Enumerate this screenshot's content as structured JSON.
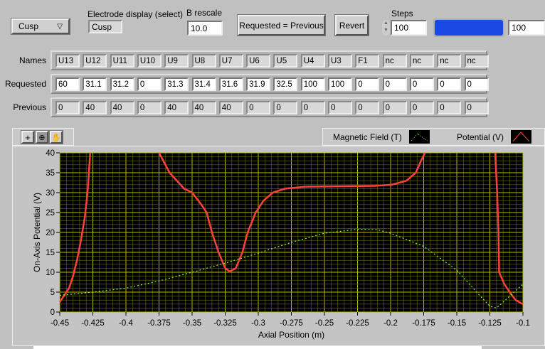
{
  "controls": {
    "mode_select": "Cusp",
    "electrode_display_label": "Electrode display (select)",
    "electrode_display_value": "Cusp",
    "b_rescale_label": "B rescale",
    "b_rescale_value": "10.0",
    "requested_equals_previous": "Requested = Previous",
    "revert": "Revert",
    "steps_label": "Steps",
    "steps_value": "100",
    "progress_percent": 100,
    "progress_color": "#1a49e6",
    "progress_value": "100"
  },
  "table": {
    "row_labels": [
      "Names",
      "Requested",
      "Previous"
    ],
    "names": [
      "U13",
      "U12",
      "U11",
      "U10",
      "U9",
      "U8",
      "U7",
      "U6",
      "U5",
      "U4",
      "U3",
      "F1",
      "nc",
      "nc",
      "nc",
      "nc"
    ],
    "requested": [
      "60",
      "31.1",
      "31.2",
      "0",
      "31.3",
      "31.4",
      "31.6",
      "31.9",
      "32.5",
      "100",
      "100",
      "0",
      "0",
      "0",
      "0",
      "0"
    ],
    "previous": [
      "0",
      "40",
      "40",
      "0",
      "40",
      "40",
      "40",
      "0",
      "0",
      "0",
      "0",
      "0",
      "0",
      "0",
      "0",
      "0"
    ]
  },
  "legend": {
    "magnetic": "Magnetic Field (T)",
    "potential": "Potential (V)"
  },
  "chart_data": {
    "type": "line",
    "xlabel": "Axial Position (m)",
    "ylabel": "On-Axis Potential (V)",
    "xlim": [
      -0.45,
      -0.1
    ],
    "ylim": [
      0,
      40
    ],
    "grid": true,
    "legend_position": "top-right",
    "x_ticks": [
      "-0.45",
      "-0.425",
      "-0.4",
      "-0.375",
      "-0.35",
      "-0.325",
      "-0.3",
      "-0.275",
      "-0.25",
      "-0.225",
      "-0.2",
      "-0.175",
      "-0.15",
      "-0.125",
      "-0.1"
    ],
    "y_ticks": [
      "0",
      "5",
      "10",
      "15",
      "20",
      "25",
      "30",
      "35",
      "40"
    ],
    "series": [
      {
        "name": "Potential (V)",
        "color": "#ff4040",
        "segments": [
          [
            [
              -0.45,
              2.5
            ],
            [
              -0.447,
              4
            ],
            [
              -0.443,
              6
            ],
            [
              -0.44,
              9
            ],
            [
              -0.437,
              13
            ],
            [
              -0.434,
              18
            ],
            [
              -0.431,
              24
            ],
            [
              -0.429,
              30
            ],
            [
              -0.428,
              35
            ],
            [
              -0.427,
              40
            ]
          ],
          [
            [
              -0.375,
              40
            ],
            [
              -0.367,
              35
            ],
            [
              -0.356,
              31
            ],
            [
              -0.35,
              30
            ],
            [
              -0.343,
              27
            ],
            [
              -0.339,
              25
            ],
            [
              -0.335,
              20
            ],
            [
              -0.33,
              15
            ],
            [
              -0.325,
              11
            ],
            [
              -0.3216,
              10.2
            ],
            [
              -0.317,
              11
            ],
            [
              -0.312,
              15
            ],
            [
              -0.308,
              20
            ],
            [
              -0.302,
              25
            ],
            [
              -0.296,
              28
            ],
            [
              -0.289,
              30
            ],
            [
              -0.28,
              31
            ],
            [
              -0.264,
              31.5
            ],
            [
              -0.233,
              31.6
            ],
            [
              -0.212,
              31.7
            ],
            [
              -0.199,
              32
            ],
            [
              -0.188,
              33
            ],
            [
              -0.181,
              35
            ],
            [
              -0.177,
              38
            ],
            [
              -0.174,
              40
            ]
          ],
          [
            [
              -0.121,
              40
            ],
            [
              -0.1195,
              30
            ],
            [
              -0.1185,
              20
            ],
            [
              -0.118,
              10
            ],
            [
              -0.114,
              7
            ],
            [
              -0.11,
              5
            ],
            [
              -0.1055,
              3
            ],
            [
              -0.1,
              2
            ]
          ]
        ]
      },
      {
        "name": "Magnetic Field (T)",
        "color": "#7fff3f",
        "segments": [
          [
            [
              -0.45,
              4.2
            ],
            [
              -0.425,
              5
            ],
            [
              -0.4,
              6
            ],
            [
              -0.375,
              7.8
            ],
            [
              -0.35,
              10
            ],
            [
              -0.325,
              12.3
            ],
            [
              -0.3,
              14.8
            ],
            [
              -0.275,
              17.5
            ],
            [
              -0.25,
              19.8
            ],
            [
              -0.225,
              20.8
            ],
            [
              -0.21,
              20.7
            ],
            [
              -0.2,
              19.8
            ],
            [
              -0.175,
              16.5
            ],
            [
              -0.15,
              10.5
            ],
            [
              -0.135,
              5
            ],
            [
              -0.125,
              1.5
            ],
            [
              -0.12,
              1
            ],
            [
              -0.115,
              2.5
            ],
            [
              -0.1,
              7
            ]
          ]
        ]
      }
    ]
  }
}
